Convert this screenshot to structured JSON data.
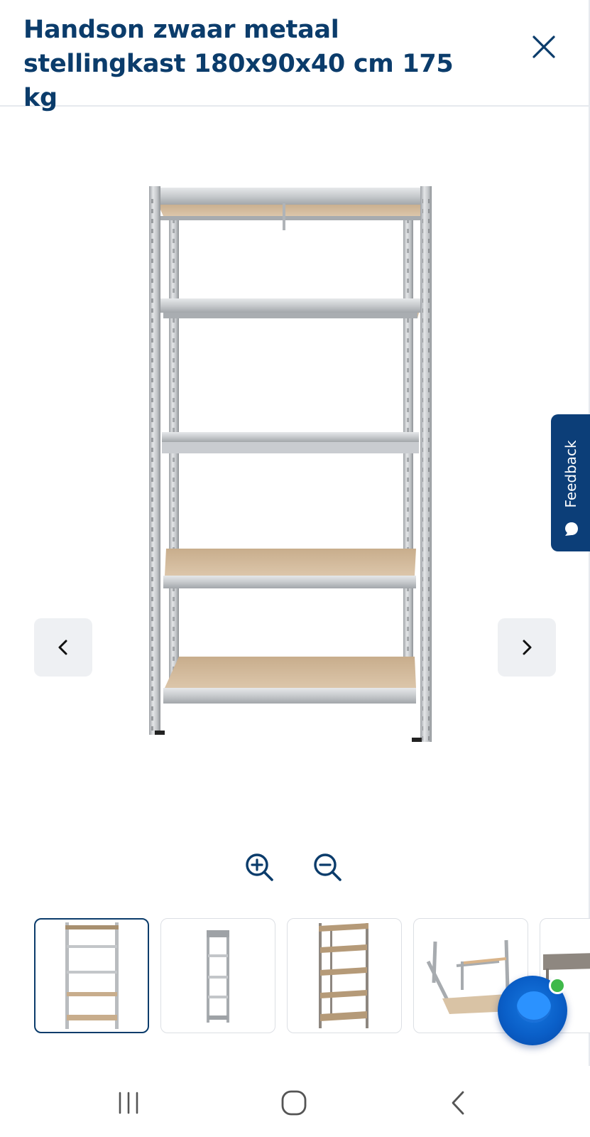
{
  "header": {
    "title": "Handson zwaar metaal stellingkast 180x90x40 cm 175 kg"
  },
  "icons": {
    "close": "close-icon",
    "prev": "chevron-left-icon",
    "next": "chevron-right-icon",
    "zoom_in": "zoom-in-icon",
    "zoom_out": "zoom-out-icon",
    "feedback": "speech-bubble-icon",
    "chat": "chat-bubble-icon"
  },
  "feedback": {
    "label": "Feedback"
  },
  "colors": {
    "brand": "#0b3c6b",
    "feedback_bg": "#0c3e78",
    "button_bg": "#eef0f3",
    "chat_blue": "#0a5fc8",
    "online_dot": "#3fb94a"
  },
  "gallery": {
    "selected_index": 0,
    "thumbnails": [
      "front view",
      "side view",
      "angled view",
      "frame detail",
      "shelf detail"
    ]
  },
  "system_nav": {
    "buttons": [
      "recent-apps",
      "home",
      "back"
    ]
  }
}
